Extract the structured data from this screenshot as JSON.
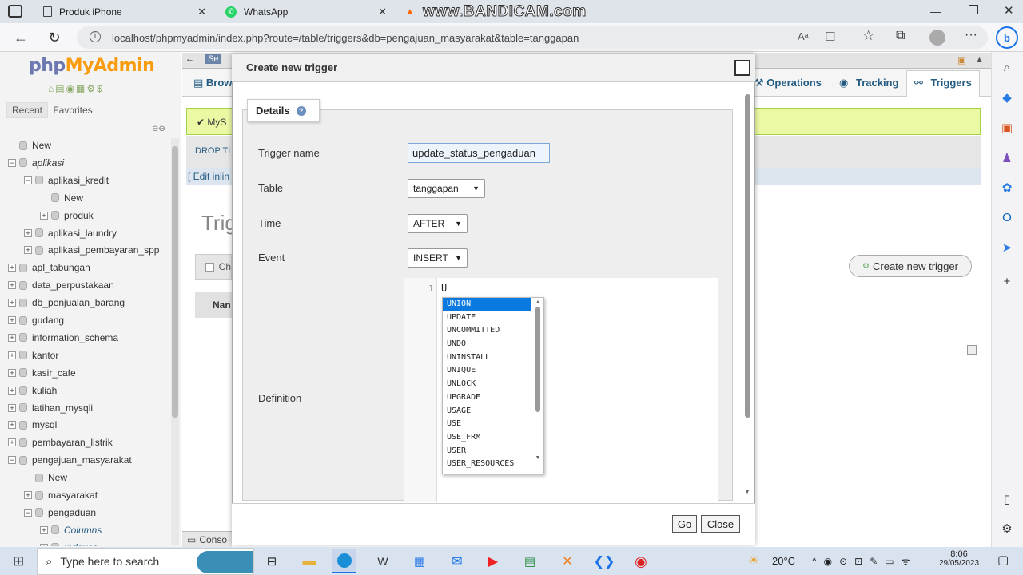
{
  "browser": {
    "tabs": [
      {
        "label": "Produk iPhone",
        "active": false
      },
      {
        "label": "WhatsApp",
        "active": false
      },
      {
        "label": "www.BANDICAM.com",
        "active": true
      }
    ],
    "url": "localhost/phpmyadmin/index.php?route=/table/triggers&db=pengajuan_masyarakat&table=tanggapan"
  },
  "pma": {
    "logo_a": "php",
    "logo_b": "MyAdmin",
    "recent": "Recent",
    "favorites": "Favorites",
    "tree": [
      {
        "label": "New",
        "indent": 0
      },
      {
        "label": "aplikasi",
        "indent": 0,
        "italic": true
      },
      {
        "label": "aplikasi_kredit",
        "indent": 1
      },
      {
        "label": "New",
        "indent": 2
      },
      {
        "label": "produk",
        "indent": 2
      },
      {
        "label": "aplikasi_laundry",
        "indent": 1
      },
      {
        "label": "aplikasi_pembayaran_spp",
        "indent": 1
      },
      {
        "label": "apl_tabungan",
        "indent": 0
      },
      {
        "label": "data_perpustakaan",
        "indent": 0
      },
      {
        "label": "db_penjualan_barang",
        "indent": 0
      },
      {
        "label": "gudang",
        "indent": 0
      },
      {
        "label": "information_schema",
        "indent": 0
      },
      {
        "label": "kantor",
        "indent": 0
      },
      {
        "label": "kasir_cafe",
        "indent": 0
      },
      {
        "label": "kuliah",
        "indent": 0
      },
      {
        "label": "latihan_mysqli",
        "indent": 0
      },
      {
        "label": "mysql",
        "indent": 0
      },
      {
        "label": "pembayaran_listrik",
        "indent": 0
      },
      {
        "label": "pengajuan_masyarakat",
        "indent": 0
      },
      {
        "label": "New",
        "indent": 1
      },
      {
        "label": "masyarakat",
        "indent": 1
      },
      {
        "label": "pengaduan",
        "indent": 1
      },
      {
        "label": "Columns",
        "indent": 2,
        "italic": true
      },
      {
        "label": "Indexes",
        "indent": 2,
        "italic": true
      }
    ],
    "tabs": {
      "browse": "Brow",
      "operations": "Operations",
      "tracking": "Tracking",
      "triggers": "Triggers"
    },
    "server_crumb": "Se",
    "mysql_msg": "MyS",
    "drop_link": "DROP",
    "ti_link": "TI",
    "edit_inline": "[ Edit inlin",
    "triggers_heading": "Trig",
    "check_label": "Ch",
    "name_col": "Nan",
    "create_trigger_btn": "Create new trigger",
    "console": "Conso"
  },
  "dialog": {
    "title": "Create new trigger",
    "legend": "Details",
    "trigger_name_label": "Trigger name",
    "trigger_name_value": "update_status_pengaduan",
    "table_label": "Table",
    "table_value": "tanggapan",
    "time_label": "Time",
    "time_value": "AFTER",
    "event_label": "Event",
    "event_value": "INSERT",
    "definition_label": "Definition",
    "line_no": "1",
    "editor_text": "U",
    "hints": [
      "UNION",
      "UPDATE",
      "UNCOMMITTED",
      "UNDO",
      "UNINSTALL",
      "UNIQUE",
      "UNLOCK",
      "UPGRADE",
      "USAGE",
      "USE",
      "USE_FRM",
      "USER",
      "USER_RESOURCES"
    ],
    "go_btn": "Go",
    "close_btn": "Close"
  },
  "taskbar": {
    "search_placeholder": "Type here to search",
    "weather": "20°C",
    "time": "8:06",
    "date": "29/05/2023"
  },
  "colors": {
    "accent": "#0b7ae0",
    "pma_blue": "#235a81",
    "notice_bg": "#ebf8a4"
  }
}
